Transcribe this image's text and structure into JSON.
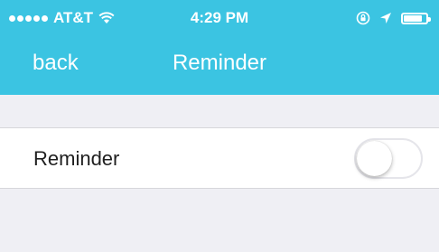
{
  "status_bar": {
    "carrier": "AT&T",
    "time": "4:29 PM",
    "signal_icon": "signal-dots-icon",
    "wifi_icon": "wifi-icon",
    "lock_icon": "rotation-lock-icon",
    "location_icon": "location-arrow-icon",
    "battery_icon": "battery-icon",
    "battery_level": 0.85
  },
  "nav": {
    "back_label": "back",
    "title": "Reminder"
  },
  "settings": {
    "reminder": {
      "label": "Reminder",
      "enabled": false
    }
  },
  "colors": {
    "accent": "#3bc4e2",
    "background": "#efeff4",
    "row": "#ffffff"
  }
}
